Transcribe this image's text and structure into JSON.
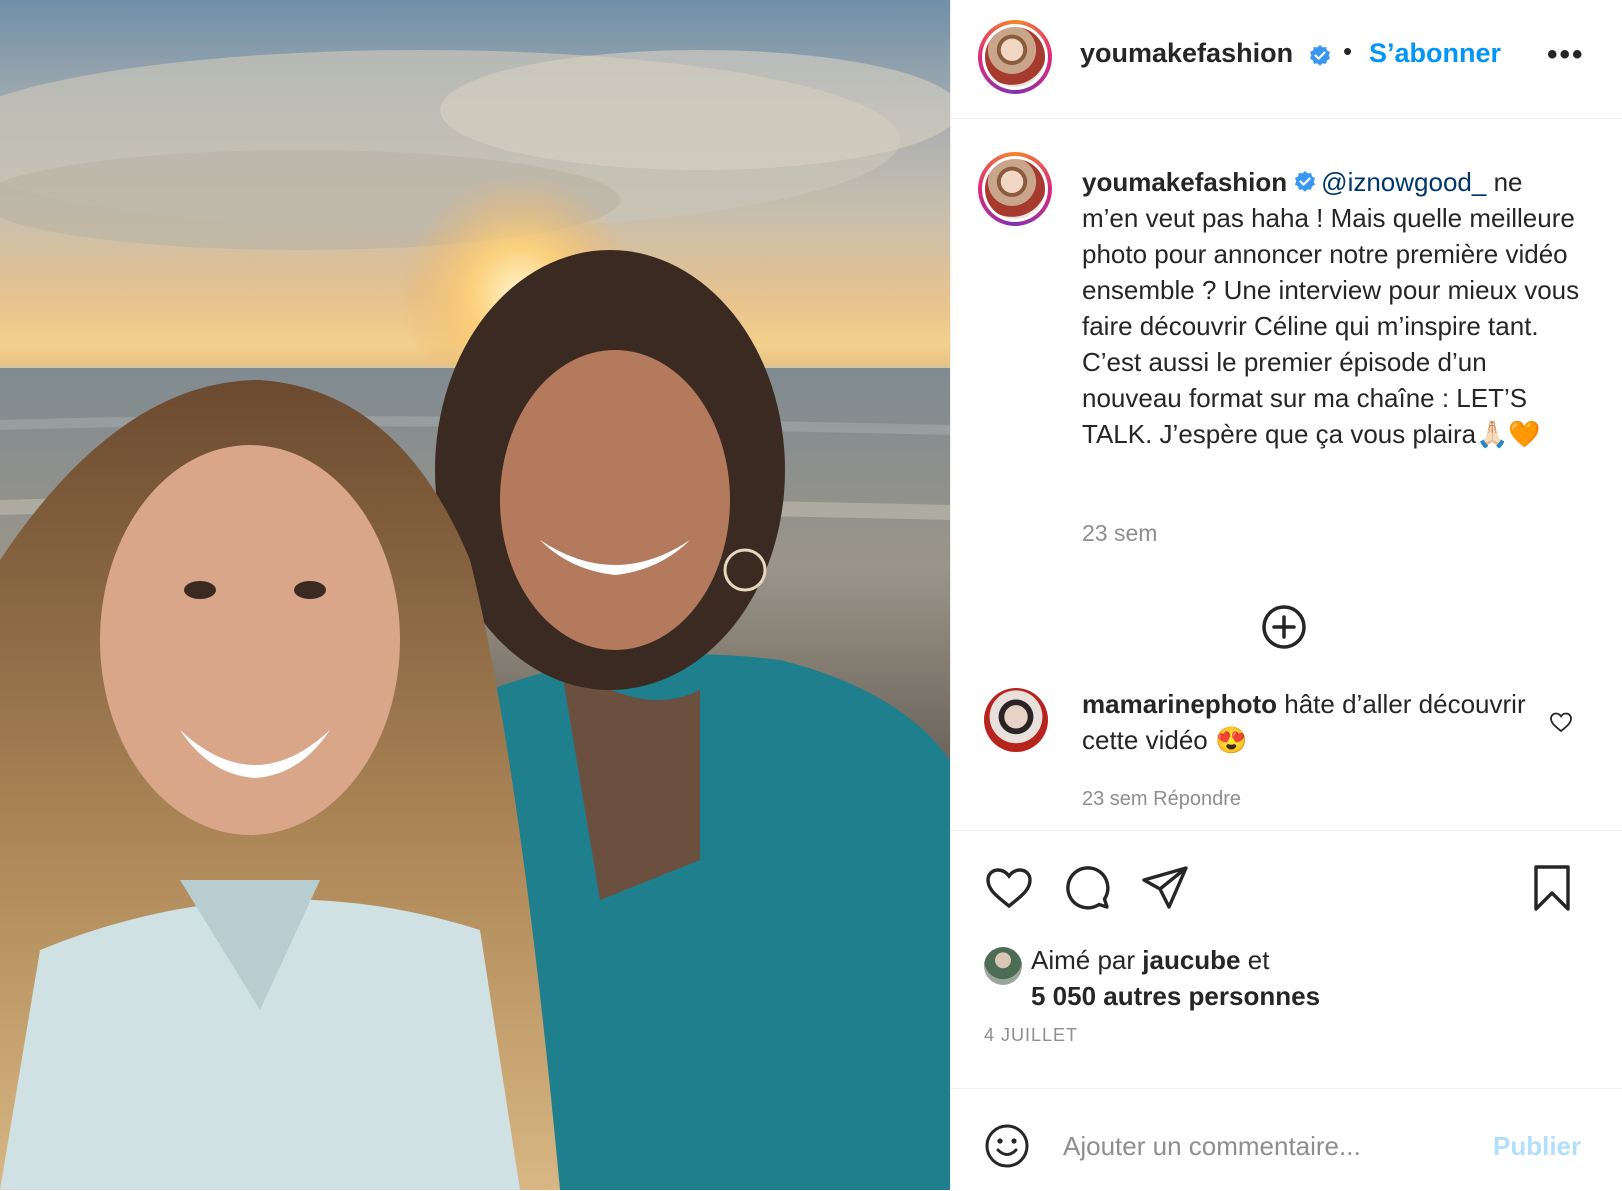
{
  "header": {
    "username": "youmakefashion",
    "separator": "•",
    "follow_label": "S’abonner",
    "more_label": "•••"
  },
  "caption": {
    "username": "youmakefashion",
    "mention": "@iznowgood_",
    "text": " ne m’en veut pas haha ! Mais quelle meilleure photo pour annoncer notre première vidéo ensemble ? Une interview pour mieux vous faire découvrir Céline qui m’inspire tant. C’est aussi le premier épisode d’un nouveau format sur ma chaîne : LET’S TALK. J’espère que ça vous plaira🙏🏻🧡",
    "time": "23 sem"
  },
  "comment": {
    "username": "mamarinephoto",
    "text": " hâte d’aller découvrir cette vidéo 😍",
    "meta": "23 sem    Répondre"
  },
  "likes": {
    "prefix": "Aimé par ",
    "liker": "jaucube",
    "middle": " et",
    "others": "5 050 autres personnes",
    "date": "4 JUILLET"
  },
  "add_comment": {
    "placeholder": "Ajouter un commentaire...",
    "publish_label": "Publier"
  },
  "icons": {
    "verified": "verified-badge-icon",
    "like": "heart-icon",
    "comment": "comment-bubble-icon",
    "share": "paper-plane-icon",
    "save": "bookmark-icon",
    "more_comments": "plus-circle-icon",
    "emoji": "smiley-icon"
  },
  "colors": {
    "accent": "#0095f6",
    "mention": "#00376b",
    "muted": "#8e8e8e",
    "publish_disabled": "#b2dffc",
    "verified": "#3897f0"
  }
}
